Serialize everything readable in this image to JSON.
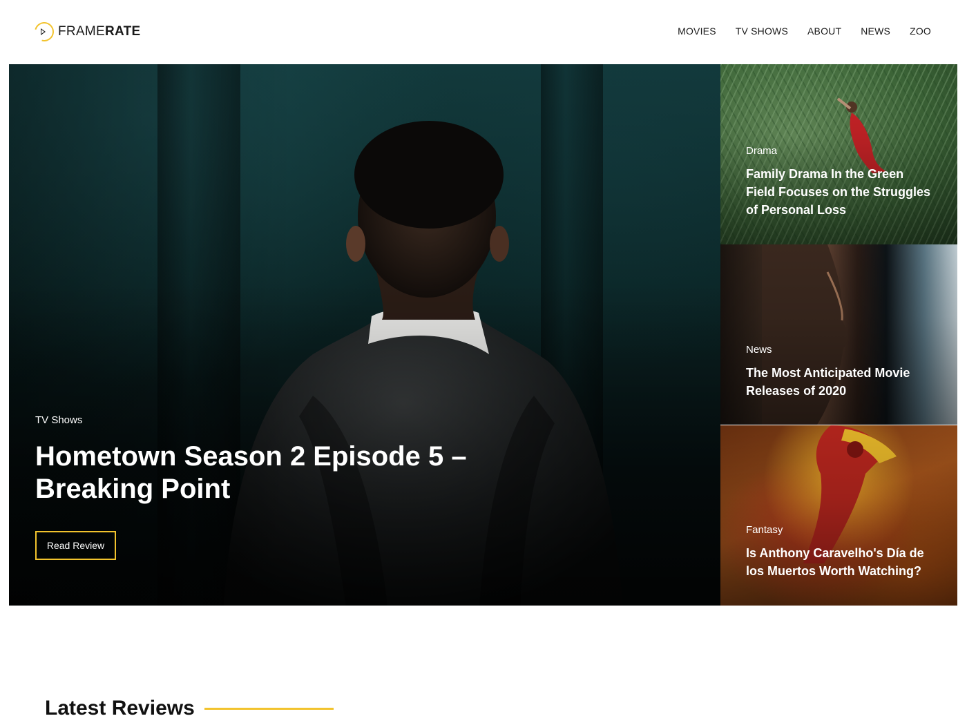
{
  "brand": {
    "name_light": "FRAME",
    "name_bold": "RATE",
    "accent_color": "#f2c32d",
    "logo_icon": "play-circle-icon"
  },
  "nav": {
    "items": [
      {
        "label": "MOVIES"
      },
      {
        "label": "TV SHOWS"
      },
      {
        "label": "ABOUT"
      },
      {
        "label": "NEWS"
      },
      {
        "label": "ZOO"
      }
    ]
  },
  "hero": {
    "category": "TV Shows",
    "title": "Hometown Season 2 Episode 5 – Breaking Point",
    "button_label": "Read Review"
  },
  "side_posts": [
    {
      "category": "Drama",
      "title": "Family Drama In the Green Field Focuses on the Struggles of Personal Loss"
    },
    {
      "category": "News",
      "title": "The Most Anticipated Movie Releases of 2020"
    },
    {
      "category": "Fantasy",
      "title": "Is Anthony Caravelho's Día de los Muertos Worth Watching?"
    }
  ],
  "latest": {
    "heading": "Latest Reviews"
  }
}
